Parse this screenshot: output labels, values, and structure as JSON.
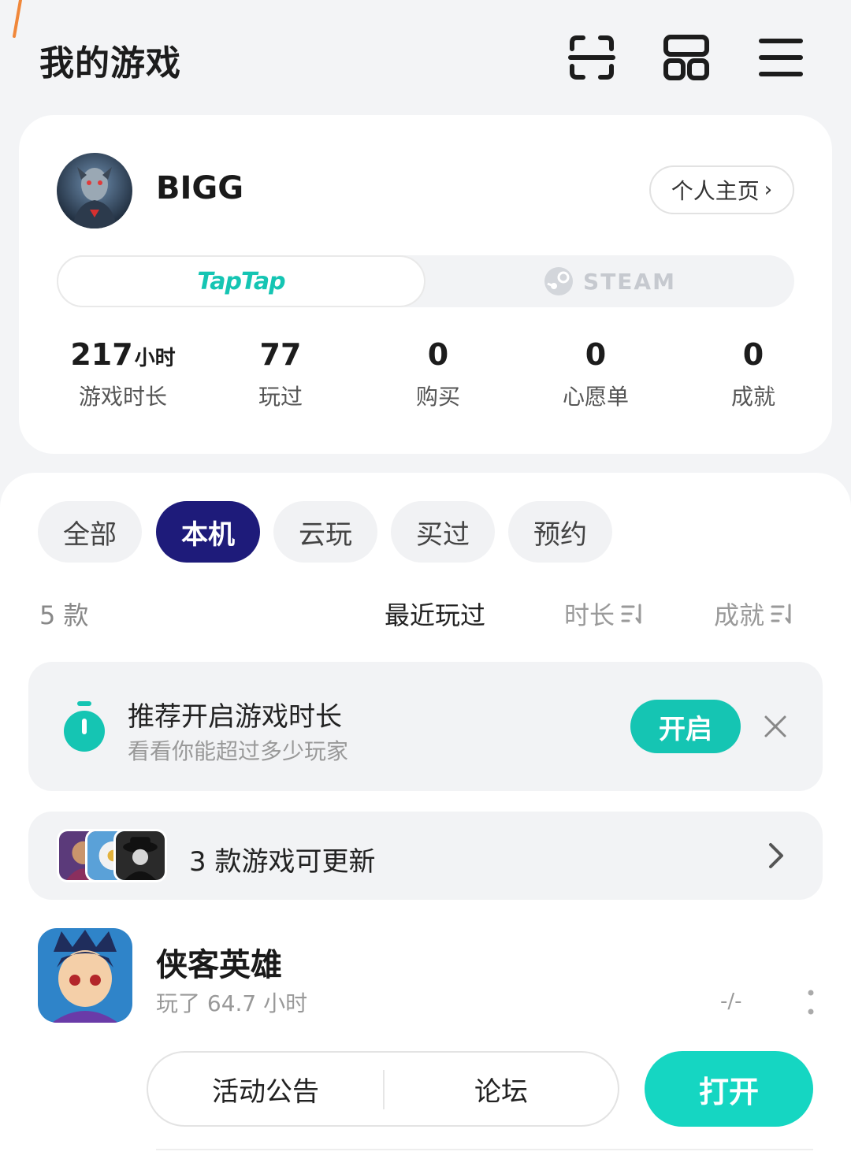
{
  "header": {
    "title": "我的游戏",
    "icons": [
      "scan-icon",
      "grid-icon",
      "menu-icon"
    ]
  },
  "profile": {
    "username": "BIGG",
    "homepage_label": "个人主页",
    "platforms": {
      "taptap_label": "TapTap",
      "steam_label": "STEAM"
    },
    "stats": [
      {
        "value": "217",
        "unit": "小时",
        "label": "游戏时长"
      },
      {
        "value": "77",
        "unit": "",
        "label": "玩过"
      },
      {
        "value": "0",
        "unit": "",
        "label": "购买"
      },
      {
        "value": "0",
        "unit": "",
        "label": "心愿单"
      },
      {
        "value": "0",
        "unit": "",
        "label": "成就"
      }
    ]
  },
  "tabs": [
    {
      "label": "全部",
      "active": false
    },
    {
      "label": "本机",
      "active": true
    },
    {
      "label": "云玩",
      "active": false
    },
    {
      "label": "买过",
      "active": false
    },
    {
      "label": "预约",
      "active": false
    }
  ],
  "list": {
    "count_label": "5 款",
    "sort": {
      "recent": "最近玩过",
      "duration": "时长",
      "achievements": "成就"
    }
  },
  "timer_banner": {
    "title": "推荐开启游戏时长",
    "subtitle": "看看你能超过多少玩家",
    "enable_label": "开启"
  },
  "update_banner": {
    "text": "3 款游戏可更新"
  },
  "game": {
    "name": "侠客英雄",
    "play_time": "玩了 64.7 小时",
    "score": "-/-",
    "actions": {
      "announcements": "活动公告",
      "forum": "论坛",
      "open": "打开"
    }
  },
  "colors": {
    "accent_teal": "#15c5b3",
    "active_tab": "#1e1b7a",
    "background": "#f3f4f6"
  }
}
